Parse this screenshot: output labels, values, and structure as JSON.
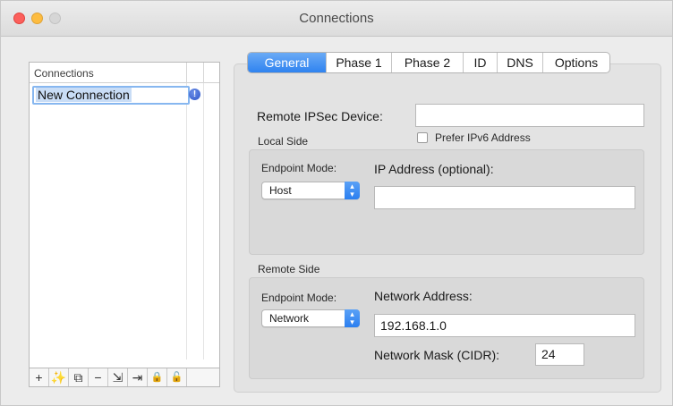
{
  "window": {
    "title": "Connections"
  },
  "sidebar": {
    "header": "Connections",
    "items": [
      {
        "label": "New Connection",
        "status_icon": "info-badge-icon"
      }
    ],
    "toolbar": [
      {
        "icon": "add-icon",
        "glyph": "+"
      },
      {
        "icon": "magic-wand-icon",
        "glyph": "✨"
      },
      {
        "icon": "duplicate-icon",
        "glyph": "⧉"
      },
      {
        "icon": "remove-icon",
        "glyph": "−"
      },
      {
        "icon": "import-icon",
        "glyph": "⇲"
      },
      {
        "icon": "export-icon",
        "glyph": "⇥"
      },
      {
        "icon": "lock-icon",
        "glyph": "🔒"
      },
      {
        "icon": "unlock-icon",
        "glyph": "🔓"
      }
    ]
  },
  "tabs": [
    "General",
    "Phase 1",
    "Phase 2",
    "ID",
    "DNS",
    "Options"
  ],
  "active_tab": "General",
  "general": {
    "remote_device_label": "Remote IPSec Device:",
    "remote_device_value": "",
    "prefer_ipv6_label": "Prefer IPv6 Address",
    "local_side": {
      "title": "Local Side",
      "endpoint_mode_label": "Endpoint Mode:",
      "endpoint_mode_value": "Host",
      "ip_label": "IP Address (optional):",
      "ip_value": ""
    },
    "remote_side": {
      "title": "Remote Side",
      "endpoint_mode_label": "Endpoint Mode:",
      "endpoint_mode_value": "Network",
      "network_address_label": "Network Address:",
      "network_address_value": "192.168.1.0",
      "network_mask_label": "Network Mask (CIDR):",
      "network_mask_value": "24"
    }
  },
  "colors": {
    "accent": "#2f83f0",
    "selection": "#c9ddf6"
  }
}
